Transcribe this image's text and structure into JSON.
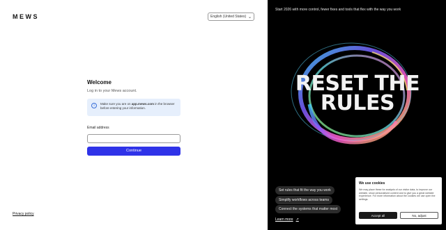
{
  "brand": {
    "logo_text": "MEWS"
  },
  "language": {
    "selected": "English (United States)"
  },
  "login": {
    "title": "Welcome",
    "subtitle": "Log in to your Mews account.",
    "info_prefix": "Make sure you are on ",
    "info_domain": "app.mews.com",
    "info_suffix": " in the browser before entering your information.",
    "email_label": "Email address",
    "email_value": "",
    "continue_label": "Continue"
  },
  "footer": {
    "privacy_label": "Privacy policy"
  },
  "promo": {
    "tagline": "Start 2026 with more control, fewer fixes and tools that flex with the way you work",
    "headline_line1": "RESET THE",
    "headline_line2": "RULES",
    "pills": [
      "Set rules that fit the way you work",
      "Simplify workflows across teams",
      "Connect the systems that matter most"
    ],
    "learn_more": "Learn more"
  },
  "cookie": {
    "title": "We use cookies",
    "text": "We may place these for analysis of our visitor data, to improve our website, show personalised content and to give you a great website experience. For more information about the cookies we use open the settings.",
    "accept_label": "Accept all",
    "adjust_label": "No, adjust"
  },
  "colors": {
    "primary_button": "#2f33e8",
    "info_background": "#e6effc",
    "promo_background": "#000000"
  }
}
